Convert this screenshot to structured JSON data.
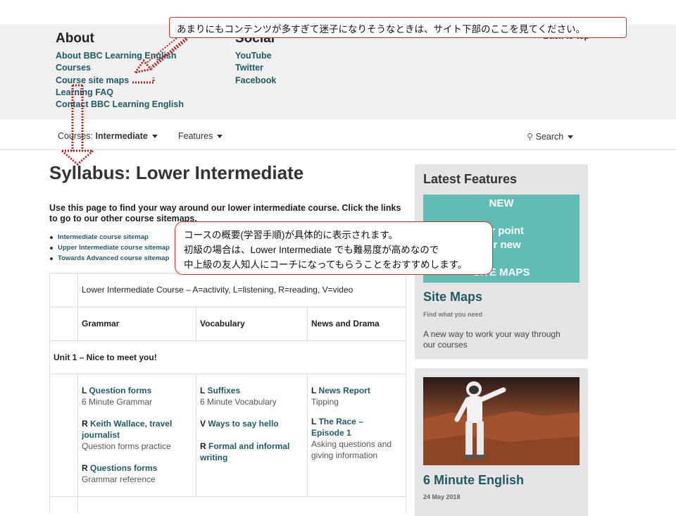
{
  "footer": {
    "about_heading": "About",
    "about_links": [
      "About BBC Learning English",
      "Courses",
      "Course site maps",
      "Learning FAQ",
      "Contact BBC Learning English"
    ],
    "social_heading": "Social",
    "social_links": [
      "YouTube",
      "Twitter",
      "Facebook"
    ],
    "back_to_top": "Back to top"
  },
  "nav": {
    "courses_prefix": "Courses:",
    "courses_value": "Intermediate",
    "features": "Features",
    "search": "Search"
  },
  "main": {
    "title": "Syllabus: Lower Intermediate",
    "intro": "Use this page to find your way around our lower intermediate course. Click the links to go to our other course sitemaps.",
    "sitemap_links": [
      "Intermediate course sitemap",
      "Upper Intermediate course sitemap",
      "Towards Advanced course sitemap"
    ]
  },
  "table": {
    "caption": "Lower Intermediate Course – A=activity, L=listening, R=reading, V=video",
    "headers": [
      "Grammar",
      "Vocabulary",
      "News and Drama"
    ],
    "unit": "Unit 1 – Nice to meet you!",
    "grammar": [
      {
        "prefix": "L",
        "link": "Question forms",
        "sub": "6 Minute Grammar"
      },
      {
        "prefix": "R",
        "link1": "Keith Wallace, travel",
        "link2": "journalist",
        "sub": "Question forms practice"
      },
      {
        "prefix": "R",
        "link": "Questions forms",
        "sub": "Grammar reference"
      }
    ],
    "vocabulary": [
      {
        "prefix": "L",
        "link": "Suffixes",
        "sub": "6 Minute Vocabulary"
      },
      {
        "prefix": "V",
        "link": "Ways to say hello"
      },
      {
        "prefix": "R",
        "link1": "Formal and informal",
        "link2": "writing"
      }
    ],
    "news": [
      {
        "prefix": "L",
        "link": "News Report",
        "sub": "Tipping"
      },
      {
        "prefix": "L",
        "link1": "The Race –",
        "link2": "Episode 1",
        "sub1": "Asking questions and",
        "sub2": "giving information"
      }
    ]
  },
  "sidebar": {
    "latest_heading": "Latest Features",
    "banner_new": "NEW",
    "banner_line1": "rammar point",
    "banner_line2": "with our new",
    "banner_bottom": "SITE MAPS",
    "sitemaps_title": "Site Maps",
    "sitemaps_small": "Find what you need",
    "sitemaps_desc1": "A new way to work your way through",
    "sitemaps_desc2": "our courses",
    "card2_title": "6 Minute English",
    "card2_date": "24 May 2018"
  },
  "callouts": {
    "top": "あまりにもコンテンツが多すぎて迷子になりそうなときは、サイト下部のここを見てください。",
    "middle_line1": "コースの概要(学習手順)が具体的に表示されます。",
    "middle_line2": "初級の場合は、Lower Intermediate でも難易度が高めなので",
    "middle_line3": "中上級の友人知人にコーチになってもらうことをおすすめします。"
  },
  "colors": {
    "link": "#1f5a66",
    "teal_banner": "#5fbdb6",
    "callout_border": "#c0392b",
    "arrow": "#b22222"
  }
}
